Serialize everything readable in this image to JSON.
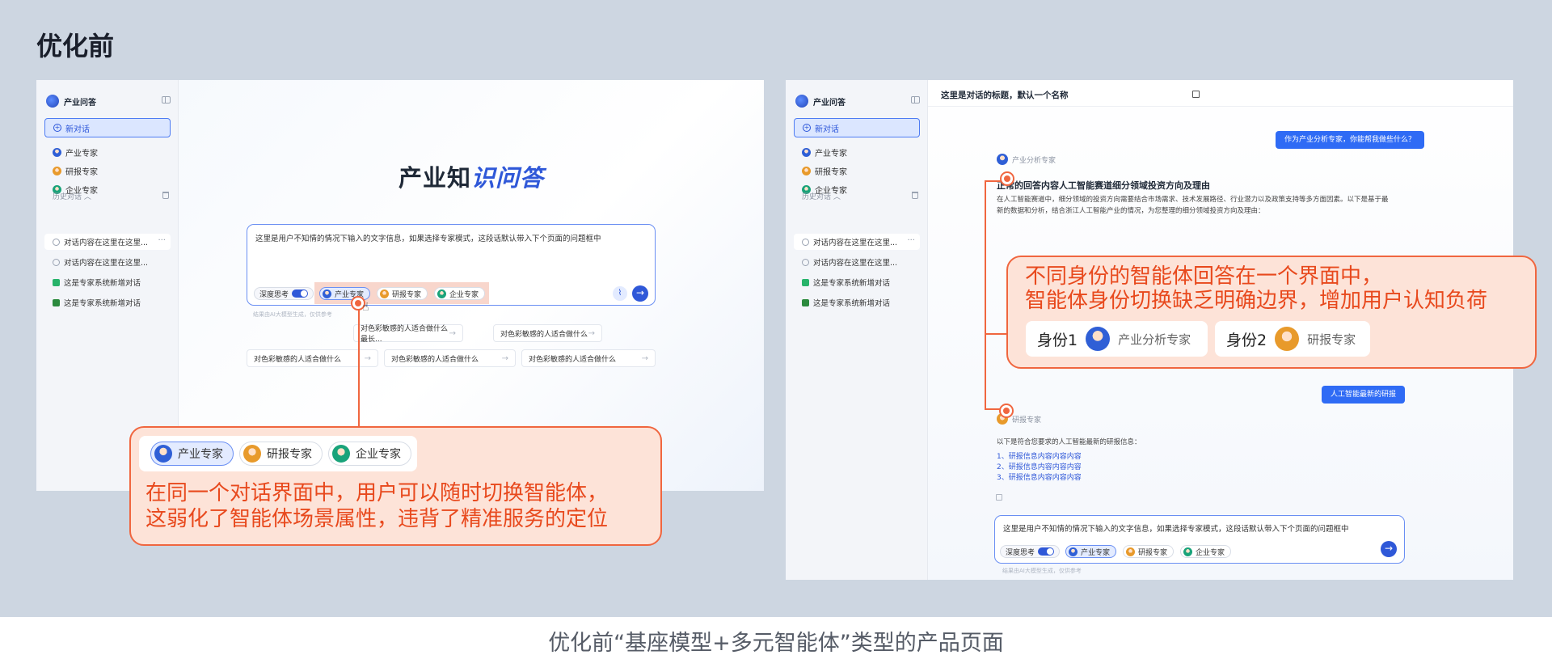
{
  "page": {
    "heading": "优化前",
    "caption": "优化前“基座模型+多元智能体”类型的产品页面"
  },
  "app": {
    "title": "产业问答",
    "new_chat": "新对话",
    "experts": [
      {
        "label": "产业专家",
        "icon": "expert-avatar-blue"
      },
      {
        "label": "研报专家",
        "icon": "expert-avatar-orange"
      },
      {
        "label": "企业专家",
        "icon": "expert-avatar-green"
      }
    ],
    "history_label": "历史对话 ︿",
    "history": [
      {
        "label": "对话内容在这里在这里...",
        "icon": "chat-icon"
      },
      {
        "label": "对话内容在这里在这里...",
        "icon": "chat-icon"
      },
      {
        "label": "这是专家系统新增对话",
        "icon": "chart-icon"
      },
      {
        "label": "这是专家系统新增对话",
        "icon": "edit-icon"
      }
    ],
    "more": "···"
  },
  "left_main": {
    "hero_prefix": "产业知",
    "hero_accent": "识问答",
    "input_text": "这里是用户不知情的情况下输入的文字信息，如果选择专家模式，这段话默认带入下个页面的问题框中",
    "deep_think": "深度思考",
    "note": "结果由AI大模型生成，仅供参考",
    "suggestions_row1": [
      "对色彩敏感的人适合做什么最长...",
      "对色彩敏感的人适合做什么"
    ],
    "suggestions_row2": [
      "对色彩敏感的人适合做什么",
      "对色彩敏感的人适合做什么",
      "对色彩敏感的人适合做什么"
    ]
  },
  "callout_left": {
    "line1": "在同一个对话界面中，用户可以随时切换智能体，",
    "line2": "这弱化了智能体场景属性，违背了精准服务的定位"
  },
  "right_main": {
    "chat_title": "这里是对话的标题，默认一个名称",
    "user_msg1": "作为产业分析专家，你能帮我做些什么？",
    "agent1_name": "产业分析专家",
    "answer_title": "正常的回答内容人工智能赛道细分领域投资方向及理由",
    "answer_line1": "在人工智能赛道中，细分领域的投资方向需要结合市场需求、技术发展路径、行业潜力以及政策支持等多方面因素。以下是基于最",
    "answer_line2": "新的数据和分析，结合浙江人工智能产业的情况，为您整理的细分领域投资方向及理由：",
    "user_msg2": "人工智能最新的研报",
    "agent2_name": "研报专家",
    "answer2_intro": "以下是符合您要求的人工智能最新的研报信息：",
    "links": [
      "1、研报信息内容内容内容",
      "2、研报信息内容内容内容",
      "3、研报信息内容内容内容"
    ],
    "input_text": "这里是用户不知情的情况下输入的文字信息，如果选择专家模式，这段话默认带入下个页面的问题框中",
    "deep_think": "深度思考",
    "note": "结果由AI大模型生成，仅供参考"
  },
  "callout_right": {
    "line1": "不同身份的智能体回答在一个界面中，",
    "line2": "智能体身份切换缺乏明确边界，增加用户认知负荷",
    "id1_label": "身份1",
    "id1_name": "产业分析专家",
    "id2_label": "身份2",
    "id2_name": "研报专家"
  },
  "colors": {
    "accent": "#2f58d8",
    "callout_border": "#f0663f",
    "callout_fill": "#fde3d8",
    "callout_text": "#e8491d",
    "background": "#cdd6e1"
  }
}
